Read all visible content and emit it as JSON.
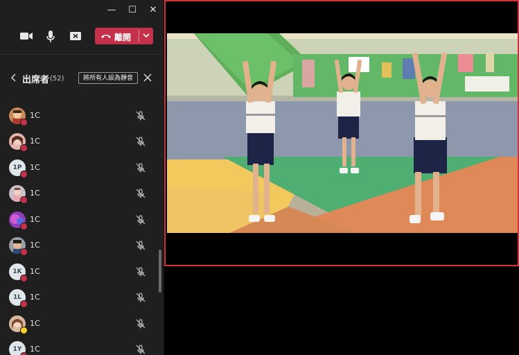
{
  "window": {
    "minimize": "—",
    "maximize": "☐",
    "close": "✕"
  },
  "toolbar": {
    "leave_label": "離開",
    "camera": "video-camera-icon",
    "mic": "microphone-icon",
    "share": "share-tray-icon"
  },
  "participants": {
    "title": "出席者",
    "count": "(52)",
    "mute_all_label": "將所有人設為靜音",
    "items": [
      {
        "name": "1C",
        "avatar": "photo",
        "status": "red"
      },
      {
        "name": "1C",
        "avatar": "photo",
        "status": "red"
      },
      {
        "name": "1C",
        "avatar": "1P",
        "status": "red"
      },
      {
        "name": "1C",
        "avatar": "photo",
        "status": "red"
      },
      {
        "name": "1C",
        "avatar": "photo",
        "status": "red"
      },
      {
        "name": "1C",
        "avatar": "photo",
        "status": "red"
      },
      {
        "name": "1C",
        "avatar": "1K",
        "status": "red"
      },
      {
        "name": "1C",
        "avatar": "1L",
        "status": "red"
      },
      {
        "name": "1C",
        "avatar": "photo",
        "status": "yellow"
      },
      {
        "name": "1C",
        "avatar": "1Y",
        "status": "red"
      }
    ]
  },
  "colors": {
    "accent_red": "#c4314b",
    "stage_border": "#d13438",
    "away_yellow": "#f8d22a"
  }
}
